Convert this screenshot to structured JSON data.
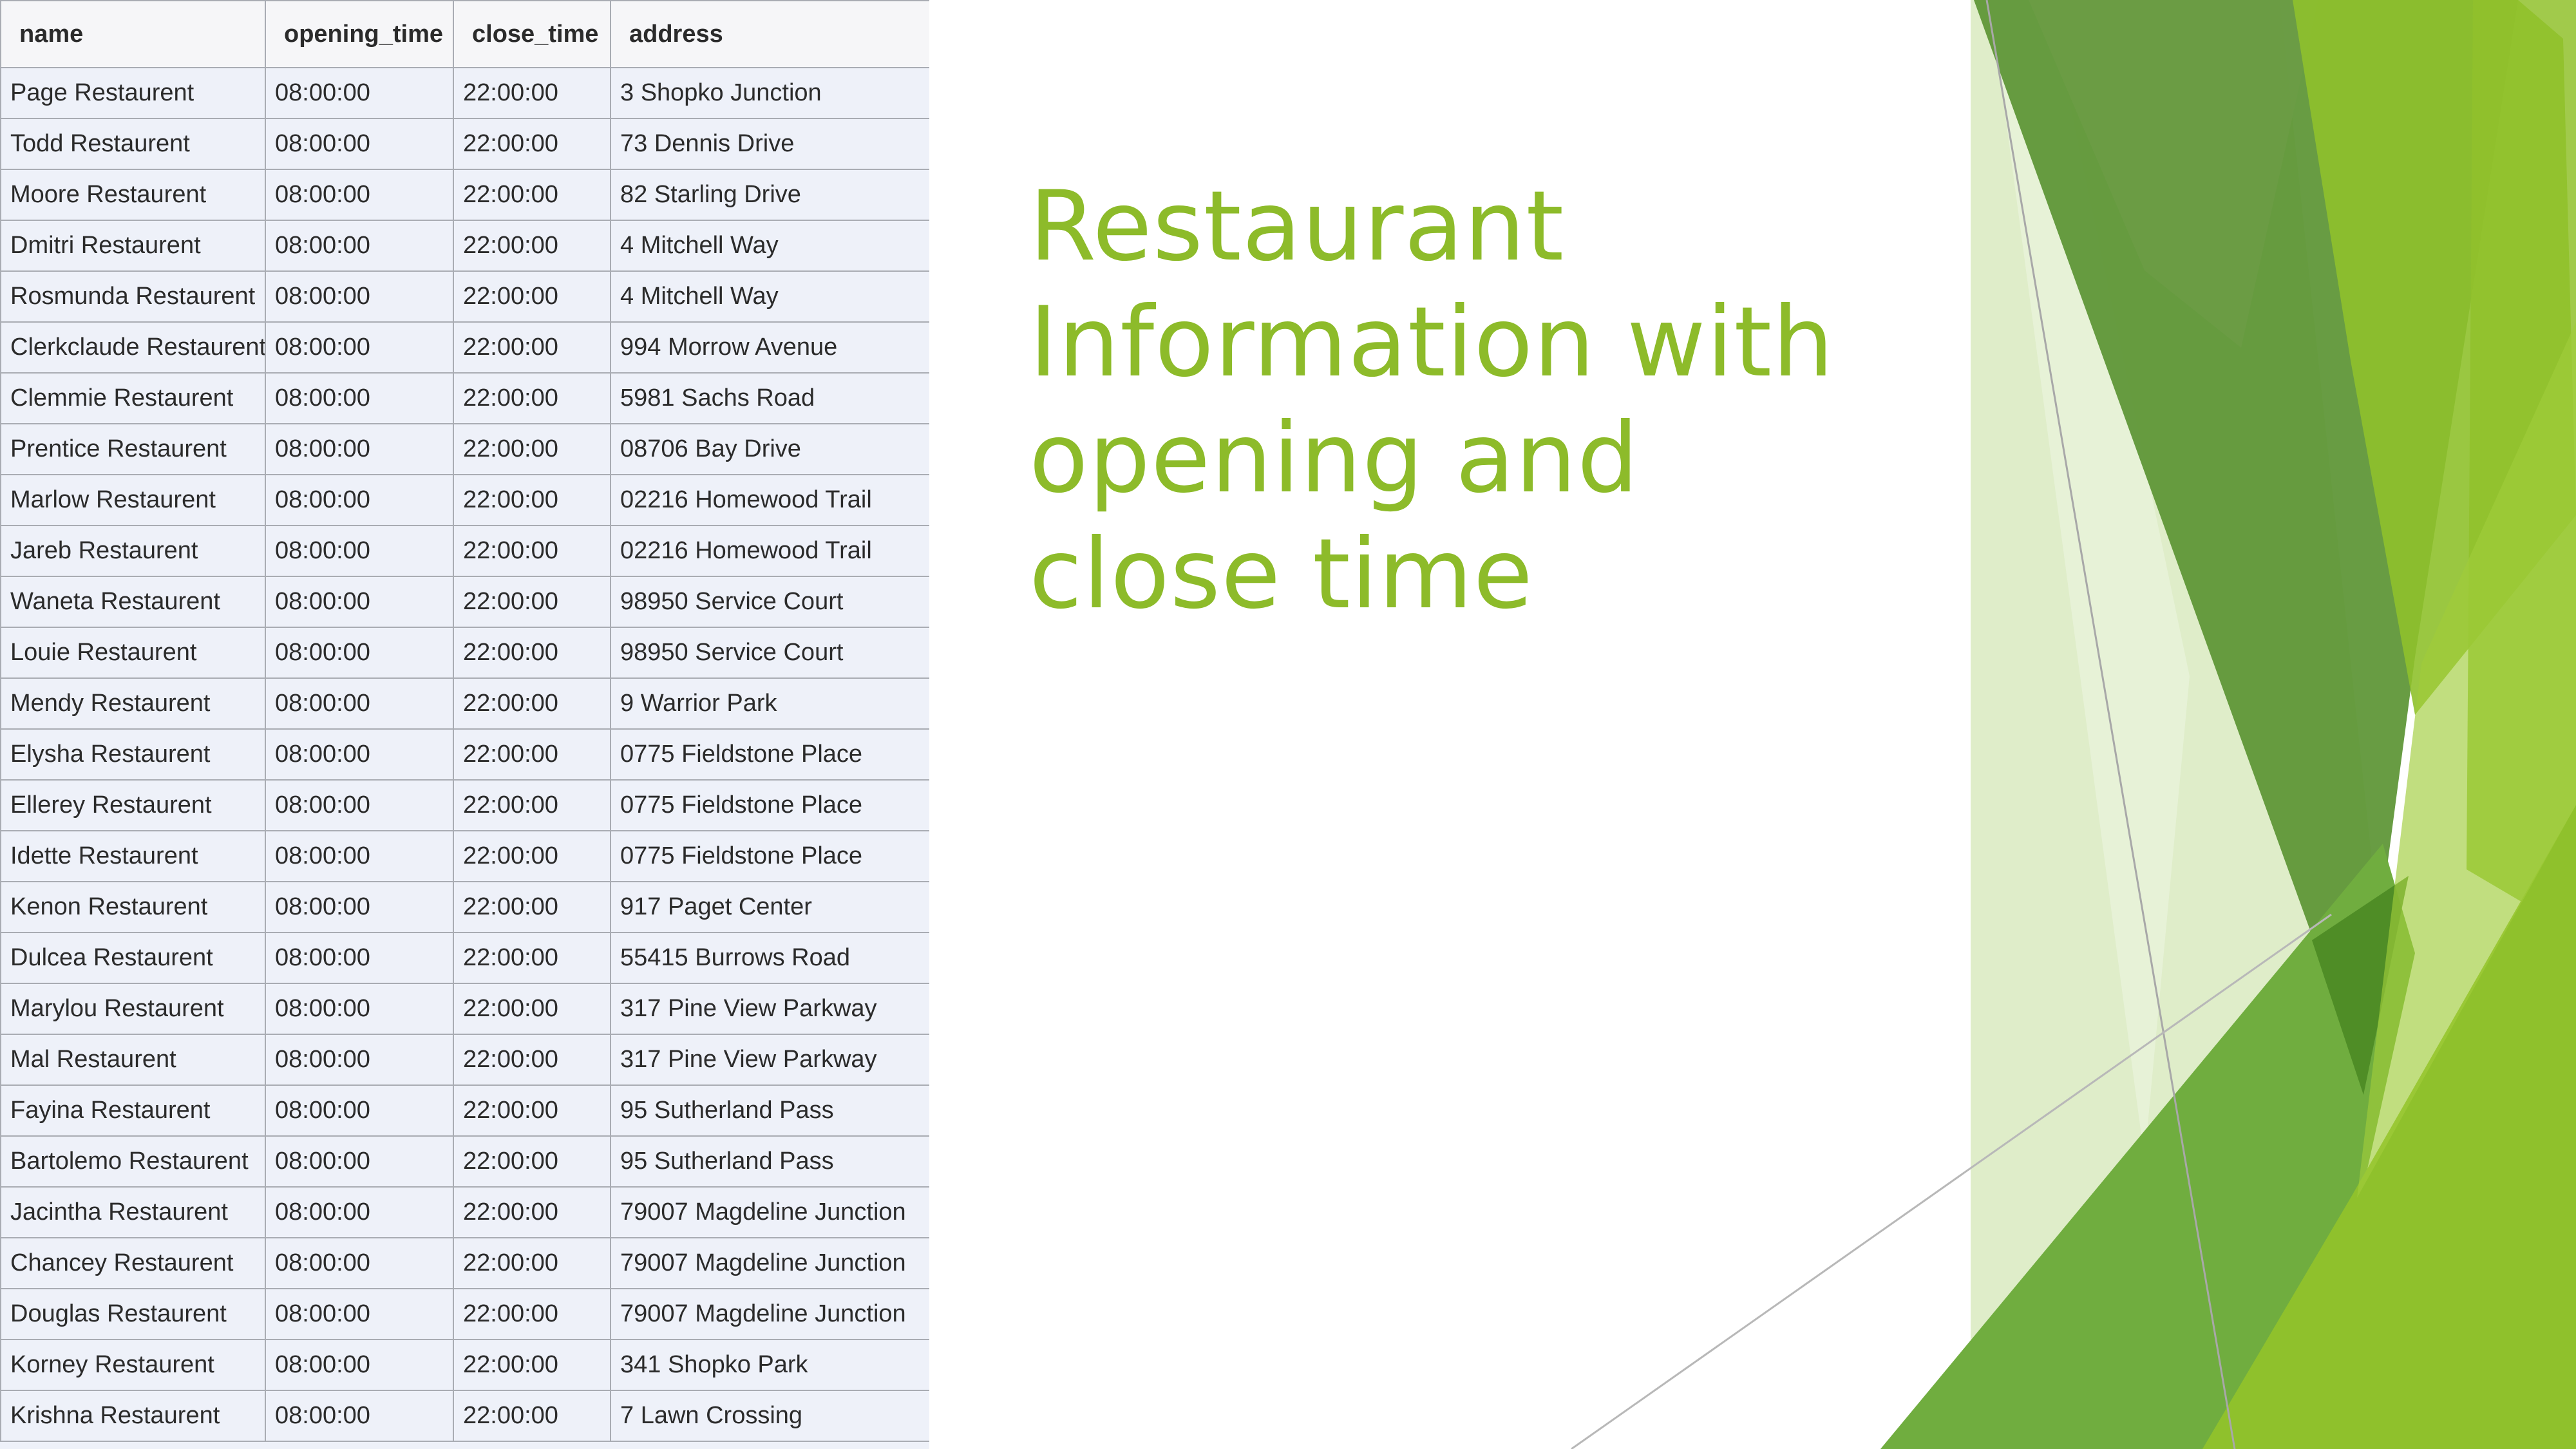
{
  "slide": {
    "title": "Restaurant Information with opening and close time"
  },
  "table": {
    "headers": {
      "name": "name",
      "opening_time": "opening_time",
      "close_time": "close_time",
      "address": "address"
    },
    "rows": [
      {
        "name": "Page Restaurent",
        "opening_time": "08:00:00",
        "close_time": "22:00:00",
        "address": "3 Shopko Junction"
      },
      {
        "name": "Todd Restaurent",
        "opening_time": "08:00:00",
        "close_time": "22:00:00",
        "address": "73 Dennis Drive"
      },
      {
        "name": "Moore Restaurent",
        "opening_time": "08:00:00",
        "close_time": "22:00:00",
        "address": "82 Starling Drive"
      },
      {
        "name": "Dmitri Restaurent",
        "opening_time": "08:00:00",
        "close_time": "22:00:00",
        "address": "4 Mitchell Way"
      },
      {
        "name": "Rosmunda Restaurent",
        "opening_time": "08:00:00",
        "close_time": "22:00:00",
        "address": "4 Mitchell Way"
      },
      {
        "name": "Clerkclaude Restaurent",
        "opening_time": "08:00:00",
        "close_time": "22:00:00",
        "address": "994 Morrow Avenue"
      },
      {
        "name": "Clemmie Restaurent",
        "opening_time": "08:00:00",
        "close_time": "22:00:00",
        "address": "5981 Sachs Road"
      },
      {
        "name": "Prentice Restaurent",
        "opening_time": "08:00:00",
        "close_time": "22:00:00",
        "address": "08706 Bay Drive"
      },
      {
        "name": "Marlow Restaurent",
        "opening_time": "08:00:00",
        "close_time": "22:00:00",
        "address": "02216 Homewood Trail"
      },
      {
        "name": "Jareb Restaurent",
        "opening_time": "08:00:00",
        "close_time": "22:00:00",
        "address": "02216 Homewood Trail"
      },
      {
        "name": "Waneta Restaurent",
        "opening_time": "08:00:00",
        "close_time": "22:00:00",
        "address": "98950 Service Court"
      },
      {
        "name": "Louie Restaurent",
        "opening_time": "08:00:00",
        "close_time": "22:00:00",
        "address": "98950 Service Court"
      },
      {
        "name": "Mendy Restaurent",
        "opening_time": "08:00:00",
        "close_time": "22:00:00",
        "address": "9 Warrior Park"
      },
      {
        "name": "Elysha Restaurent",
        "opening_time": "08:00:00",
        "close_time": "22:00:00",
        "address": "0775 Fieldstone Place"
      },
      {
        "name": "Ellerey Restaurent",
        "opening_time": "08:00:00",
        "close_time": "22:00:00",
        "address": "0775 Fieldstone Place"
      },
      {
        "name": "Idette Restaurent",
        "opening_time": "08:00:00",
        "close_time": "22:00:00",
        "address": "0775 Fieldstone Place"
      },
      {
        "name": "Kenon Restaurent",
        "opening_time": "08:00:00",
        "close_time": "22:00:00",
        "address": "917 Paget Center"
      },
      {
        "name": "Dulcea Restaurent",
        "opening_time": "08:00:00",
        "close_time": "22:00:00",
        "address": "55415 Burrows Road"
      },
      {
        "name": "Marylou Restaurent",
        "opening_time": "08:00:00",
        "close_time": "22:00:00",
        "address": "317 Pine View Parkway"
      },
      {
        "name": "Mal Restaurent",
        "opening_time": "08:00:00",
        "close_time": "22:00:00",
        "address": "317 Pine View Parkway"
      },
      {
        "name": "Fayina Restaurent",
        "opening_time": "08:00:00",
        "close_time": "22:00:00",
        "address": "95 Sutherland Pass"
      },
      {
        "name": "Bartolemo Restaurent",
        "opening_time": "08:00:00",
        "close_time": "22:00:00",
        "address": "95 Sutherland Pass"
      },
      {
        "name": "Jacintha Restaurent",
        "opening_time": "08:00:00",
        "close_time": "22:00:00",
        "address": "79007 Magdeline Junction"
      },
      {
        "name": "Chancey Restaurent",
        "opening_time": "08:00:00",
        "close_time": "22:00:00",
        "address": "79007 Magdeline Junction"
      },
      {
        "name": "Douglas Restaurent",
        "opening_time": "08:00:00",
        "close_time": "22:00:00",
        "address": "79007 Magdeline Junction"
      },
      {
        "name": "Korney Restaurent",
        "opening_time": "08:00:00",
        "close_time": "22:00:00",
        "address": "341 Shopko Park"
      },
      {
        "name": "Krishna Restaurent",
        "opening_time": "08:00:00",
        "close_time": "22:00:00",
        "address": "7 Lawn Crossing"
      }
    ]
  },
  "colors": {
    "title": "#8dbb2a",
    "table_bg": "#eef1f9",
    "grid": "#a9acb3",
    "facet_dark": "#5b9433",
    "facet_mid": "#78ad3d",
    "facet_lime": "#8fc12c",
    "facet_pale": "#d9eabf"
  }
}
